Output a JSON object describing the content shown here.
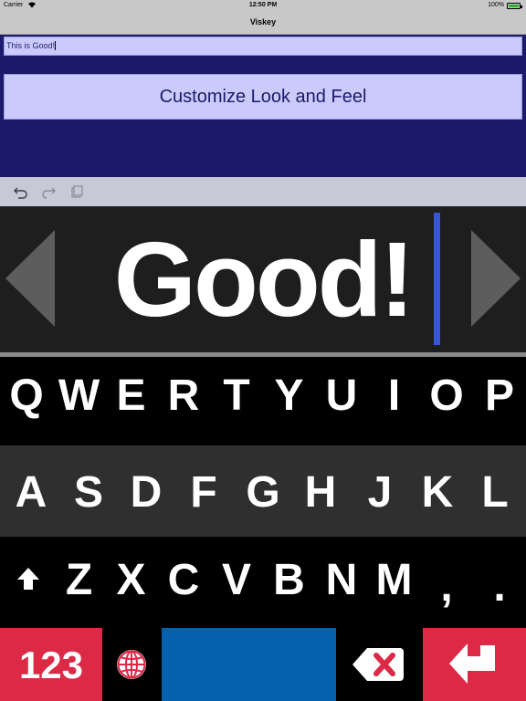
{
  "status_bar": {
    "carrier": "Carrier",
    "time": "12:50 PM",
    "battery": "100%"
  },
  "nav": {
    "title": "Viskey"
  },
  "text_field": {
    "value": "This is Good!"
  },
  "customize_button": {
    "label": "Customize Look and Feel"
  },
  "toolbar": {
    "icons": [
      "undo-icon",
      "redo-icon",
      "paste-icon"
    ]
  },
  "preview": {
    "word": "Good!"
  },
  "keyboard": {
    "row1": [
      "Q",
      "W",
      "E",
      "R",
      "T",
      "Y",
      "U",
      "I",
      "O",
      "P"
    ],
    "row2": [
      "A",
      "S",
      "D",
      "F",
      "G",
      "H",
      "J",
      "K",
      "L"
    ],
    "row3": [
      "Z",
      "X",
      "C",
      "V",
      "B",
      "N",
      "M",
      ",",
      "."
    ],
    "numbers_label": "123",
    "colors": {
      "action_red": "#dc2946",
      "space_blue": "#0461ae",
      "app_navy": "#1b1a6b",
      "field_lavender": "#cbcbfb",
      "cursor_blue": "#3557d6"
    }
  }
}
